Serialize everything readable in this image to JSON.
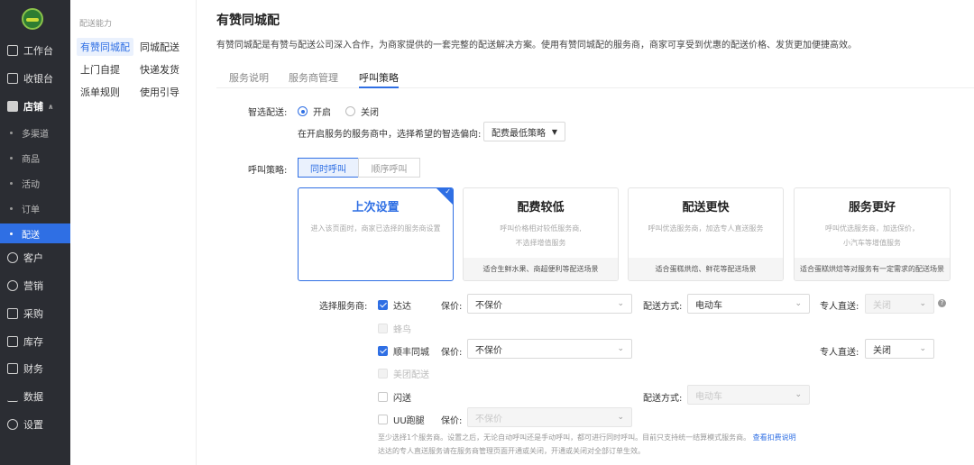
{
  "sidebar": {
    "items": [
      {
        "label": "工作台",
        "icon": "workbench-icon"
      },
      {
        "label": "收银台",
        "icon": "cashier-icon"
      },
      {
        "label": "店铺",
        "icon": "store-icon"
      },
      {
        "label": "客户",
        "icon": "customer-icon"
      },
      {
        "label": "营销",
        "icon": "marketing-icon"
      },
      {
        "label": "采购",
        "icon": "cart-icon"
      },
      {
        "label": "库存",
        "icon": "inventory-icon"
      },
      {
        "label": "财务",
        "icon": "finance-icon"
      },
      {
        "label": "数据",
        "icon": "chart-icon"
      },
      {
        "label": "设置",
        "icon": "settings-icon"
      }
    ],
    "store_sub": [
      "多渠道",
      "商品",
      "活动",
      "订单",
      "配送"
    ],
    "active_sub": "配送"
  },
  "subpanel": {
    "title": "配送能力",
    "links": [
      "有赞同城配",
      "同城配送",
      "上门自提",
      "快递发货",
      "派单规则",
      "使用引导"
    ],
    "active": "有赞同城配"
  },
  "main": {
    "title": "有赞同城配",
    "description": "有赞同城配是有赞与配送公司深入合作，为商家提供的一套完整的配送解决方案。使用有赞同城配的服务商，商家可享受到优惠的配送价格、发货更加便捷高效。",
    "tabs": [
      "服务说明",
      "服务商管理",
      "呼叫策略"
    ],
    "active_tab": "呼叫策略",
    "smart_label": "智选配送:",
    "smart_on": "开启",
    "smart_off": "关闭",
    "smart_selected": "开启",
    "preference_text": "在开启服务的服务商中，选择希望的智选偏向:",
    "preference_value": "配费最低策略",
    "strategy_label": "呼叫策略:",
    "strategy_options": [
      "同时呼叫",
      "顺序呼叫"
    ],
    "strategy_selected": "同时呼叫",
    "cards": [
      {
        "title": "上次设置",
        "desc1": "进入该页面时，商家已选择的服务商设置",
        "desc2": "",
        "footer": "",
        "selected": true
      },
      {
        "title": "配费较低",
        "desc1": "呼叫价格相对较低服务商,",
        "desc2": "不选择增值服务",
        "footer": "适合生鲜水果、商超便利等配送场景",
        "selected": false
      },
      {
        "title": "配送更快",
        "desc1": "呼叫优选服务商，加选专人直送服务",
        "desc2": "",
        "footer": "适合蛋糕烘焙、鲜花等配送场景",
        "selected": false
      },
      {
        "title": "服务更好",
        "desc1": "呼叫优选服务商，加选保价，",
        "desc2": "小汽车等增值服务",
        "footer": "适合蛋糕烘焙等对服务有一定需求的配送场景",
        "selected": false
      }
    ],
    "providers_label": "选择服务商:",
    "labels": {
      "insure": "保价:",
      "method": "配送方式:",
      "direct": "专人直送:"
    },
    "providers": [
      {
        "name": "达达",
        "checked": true,
        "disabled": false,
        "insure": "不保价",
        "method": "电动车",
        "direct": "关闭",
        "direct_disabled": true
      },
      {
        "name": "蜂鸟",
        "checked": false,
        "disabled": true
      },
      {
        "name": "顺丰同城",
        "checked": true,
        "disabled": false,
        "insure": "不保价",
        "direct": "关闭",
        "direct_disabled": false
      },
      {
        "name": "美团配送",
        "checked": false,
        "disabled": true
      },
      {
        "name": "闪送",
        "checked": false,
        "disabled": false,
        "method": "电动车"
      },
      {
        "name": "UU跑腿",
        "checked": false,
        "disabled": false,
        "insure": "不保价"
      }
    ],
    "note1": "至少选择1个服务商。设置之后，无论自动呼叫还是手动呼叫，都可进行同时呼叫。目前只支持统一结算模式服务商。",
    "note1_link": "查看扣费说明",
    "note2": "达达的专人直送服务请在服务商管理页面开通或关闭，开通或关闭对全部订单生效。"
  },
  "colors": {
    "accent": "#2f6fe4",
    "sidebar_bg": "#2b2d33"
  }
}
